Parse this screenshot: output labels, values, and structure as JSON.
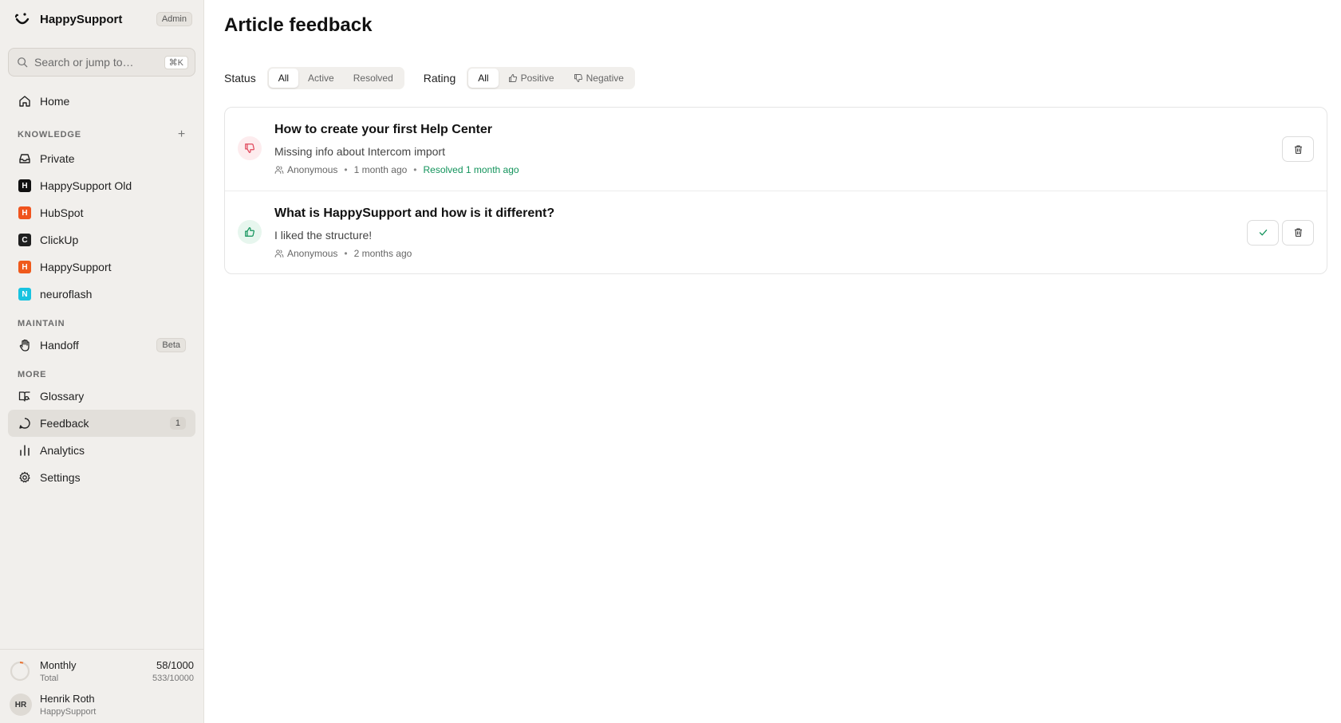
{
  "brand": {
    "name": "HappySupport",
    "role_badge": "Admin"
  },
  "search": {
    "placeholder": "Search or jump to…",
    "shortcut": "⌘K"
  },
  "nav": {
    "home": "Home",
    "knowledge_heading": "KNOWLEDGE",
    "knowledge_items": [
      {
        "label": "Private",
        "icon": "inbox-icon"
      },
      {
        "label": "HappySupport Old",
        "letter": "H",
        "color": "#111111"
      },
      {
        "label": "HubSpot",
        "letter": "H",
        "color": "#f0541e"
      },
      {
        "label": "ClickUp",
        "letter": "C",
        "color": "#1f1f1f"
      },
      {
        "label": "HappySupport",
        "letter": "H",
        "color": "#ef5a1c"
      },
      {
        "label": "neuroflash",
        "letter": "N",
        "color": "#18c3e0"
      }
    ],
    "maintain_heading": "MAINTAIN",
    "handoff": {
      "label": "Handoff",
      "badge": "Beta"
    },
    "more_heading": "MORE",
    "glossary": "Glossary",
    "feedback": {
      "label": "Feedback",
      "count": "1"
    },
    "analytics": "Analytics",
    "settings": "Settings"
  },
  "usage": {
    "label": "Monthly",
    "sublabel": "Total",
    "value": "58/1000",
    "subvalue": "533/10000",
    "progress": 0.058
  },
  "user": {
    "initials": "HR",
    "name": "Henrik Roth",
    "org": "HappySupport"
  },
  "page": {
    "title": "Article feedback"
  },
  "filters": {
    "status_label": "Status",
    "status_options": [
      "All",
      "Active",
      "Resolved"
    ],
    "status_selected": "All",
    "rating_label": "Rating",
    "rating_options": [
      "All",
      "Positive",
      "Negative"
    ],
    "rating_selected": "All"
  },
  "feedback_items": [
    {
      "rating": "negative",
      "title": "How to create your first Help Center",
      "text": "Missing info about Intercom import",
      "author": "Anonymous",
      "time": "1 month ago",
      "resolved": "Resolved 1 month ago"
    },
    {
      "rating": "positive",
      "title": "What is HappySupport and how is it different?",
      "text": "I liked the structure!",
      "author": "Anonymous",
      "time": "2 months ago"
    }
  ],
  "colors": {
    "accent_red": "#e0475b",
    "accent_green": "#12935b",
    "usage_ring": "#e8773a"
  }
}
